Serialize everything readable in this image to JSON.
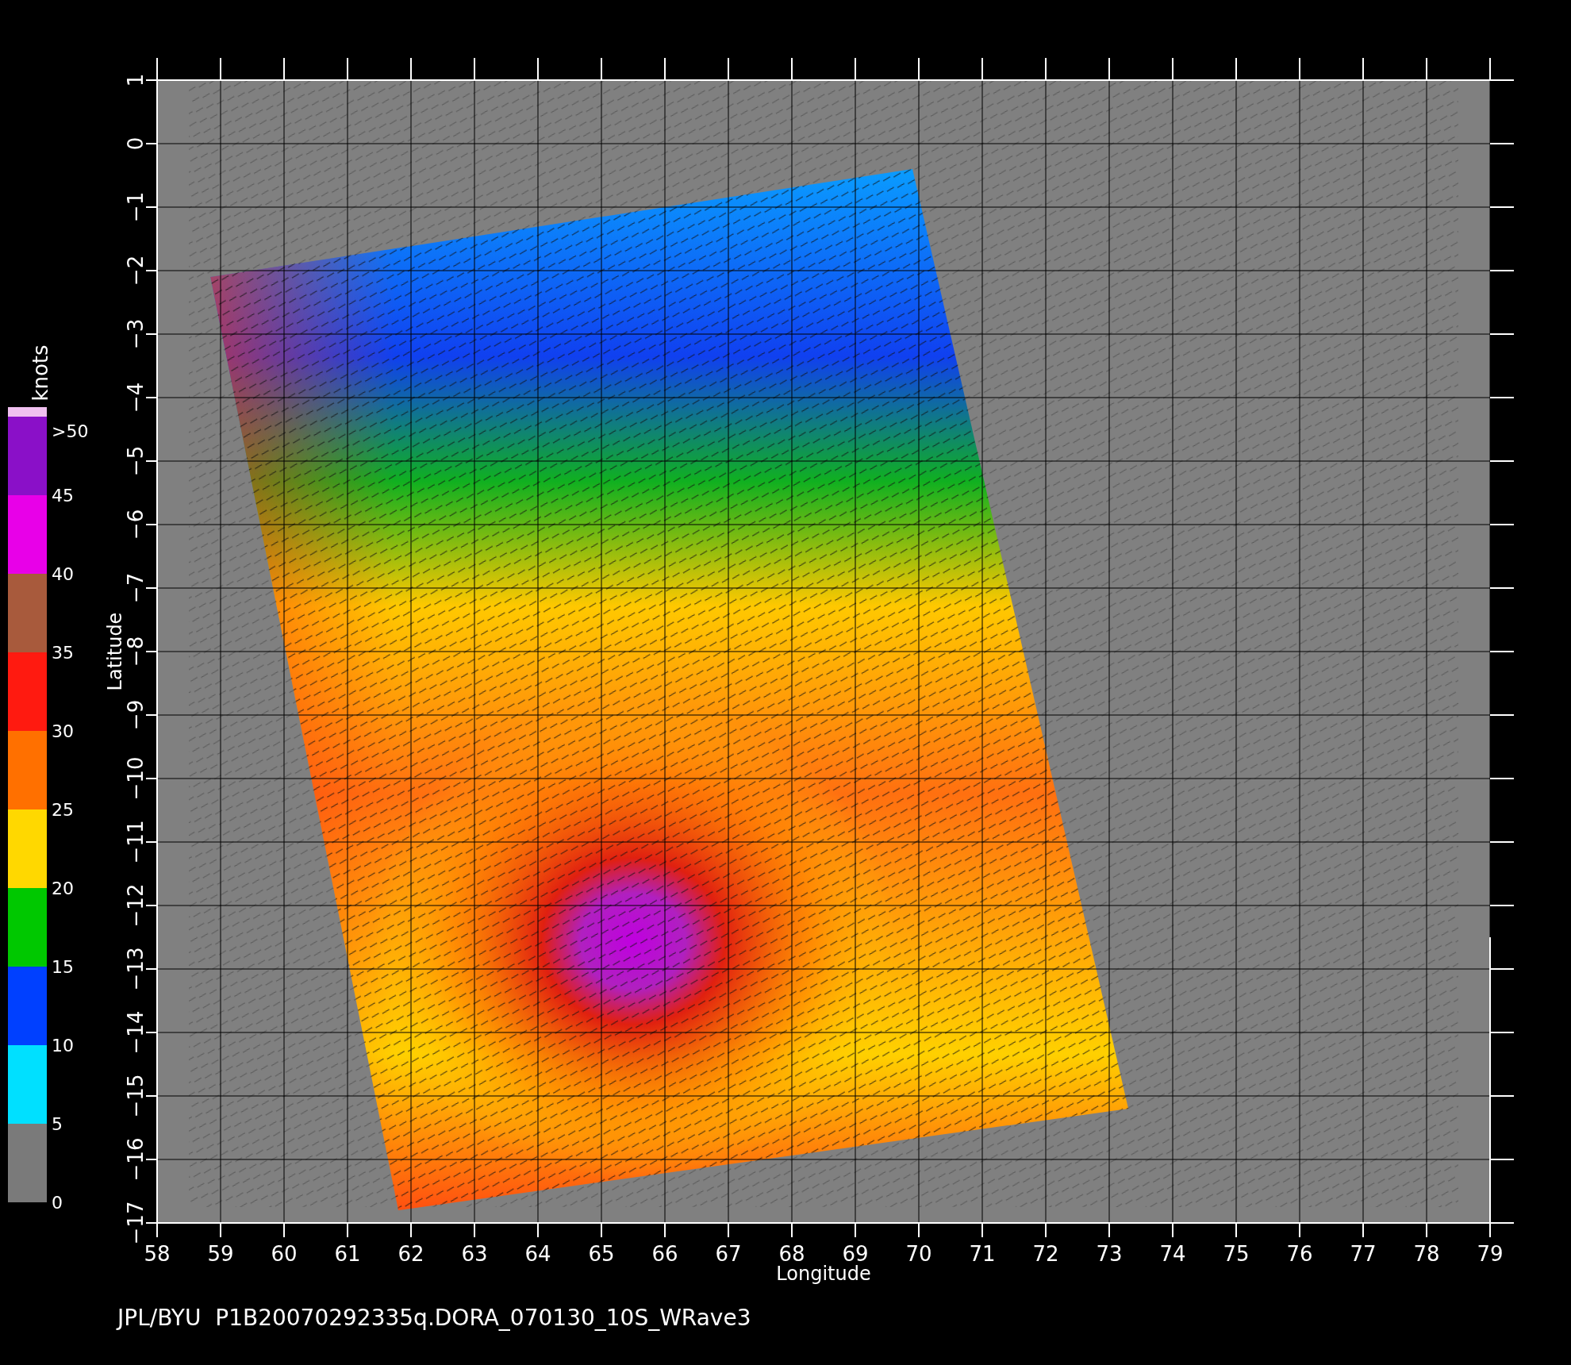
{
  "legend": {
    "unit": "knots",
    "entries": [
      {
        "label": ">50",
        "color": "#f0c0f0"
      },
      {
        "label": "45",
        "color": "#8a10c8"
      },
      {
        "label": "40",
        "color": "#e800e8"
      },
      {
        "label": "35",
        "color": "#a85a3c"
      },
      {
        "label": "30",
        "color": "#ff1a10"
      },
      {
        "label": "25",
        "color": "#ff7000"
      },
      {
        "label": "20",
        "color": "#ffd800"
      },
      {
        "label": "15",
        "color": "#00c800"
      },
      {
        "label": "10",
        "color": "#0040ff"
      },
      {
        "label": "5",
        "color": "#00e0ff"
      },
      {
        "label": "0",
        "color": "#7a7a7a"
      }
    ]
  },
  "plot": {
    "xlabel": "Longitude",
    "ylabel": "Latitude",
    "xticks": [
      "58",
      "59",
      "60",
      "61",
      "62",
      "63",
      "64",
      "65",
      "66",
      "67",
      "68",
      "69",
      "70",
      "71",
      "72",
      "73",
      "74",
      "75",
      "76",
      "77",
      "78",
      "79"
    ],
    "yticks": [
      "1",
      "0",
      "−1",
      "−2",
      "−3",
      "−4",
      "−5",
      "−6",
      "−7",
      "−8",
      "−9",
      "−10",
      "−11",
      "−12",
      "−13",
      "−14",
      "−15",
      "−16",
      "−17"
    ]
  },
  "caption": "JPL/BYU  P1B20070292335q.DORA_070130_10S_WRave3"
}
